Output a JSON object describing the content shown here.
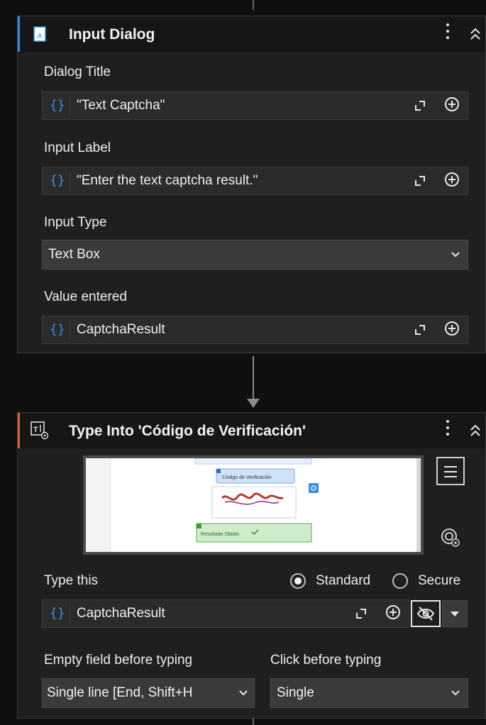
{
  "input_dialog": {
    "title": "Input Dialog",
    "dialog_title_label": "Dialog Title",
    "dialog_title_value": "\"Text Captcha\"",
    "input_label_label": "Input Label",
    "input_label_value": "\"Enter the text captcha result.\"",
    "input_type_label": "Input Type",
    "input_type_value": "Text Box",
    "value_entered_label": "Value entered",
    "value_entered_value": "CaptchaResult"
  },
  "type_into": {
    "title": "Type Into 'Código de Verificación'",
    "type_this_label": "Type this",
    "radio_standard": "Standard",
    "radio_secure": "Secure",
    "type_this_value": "CaptchaResult",
    "empty_field_label": "Empty field before typing",
    "empty_field_value": "Single line [End, Shift+H",
    "click_before_label": "Click before typing",
    "click_before_value": "Single"
  },
  "preview": {
    "box_label": "Código de Verificación",
    "result_label": "Resultado Obtido"
  },
  "colors": {
    "input_dialog_accent": "#2f8ee6",
    "type_into_accent": "#e0622e",
    "brace": "#3d8ee6"
  },
  "icons": {
    "input_dialog": "dialog-icon",
    "type_into": "type-into-icon",
    "variable": "braces-icon",
    "expand": "expand-icon",
    "add": "plus-circle-icon",
    "secret": "eye-slash-icon",
    "menu": "hamburger-icon",
    "target": "target-icon"
  }
}
